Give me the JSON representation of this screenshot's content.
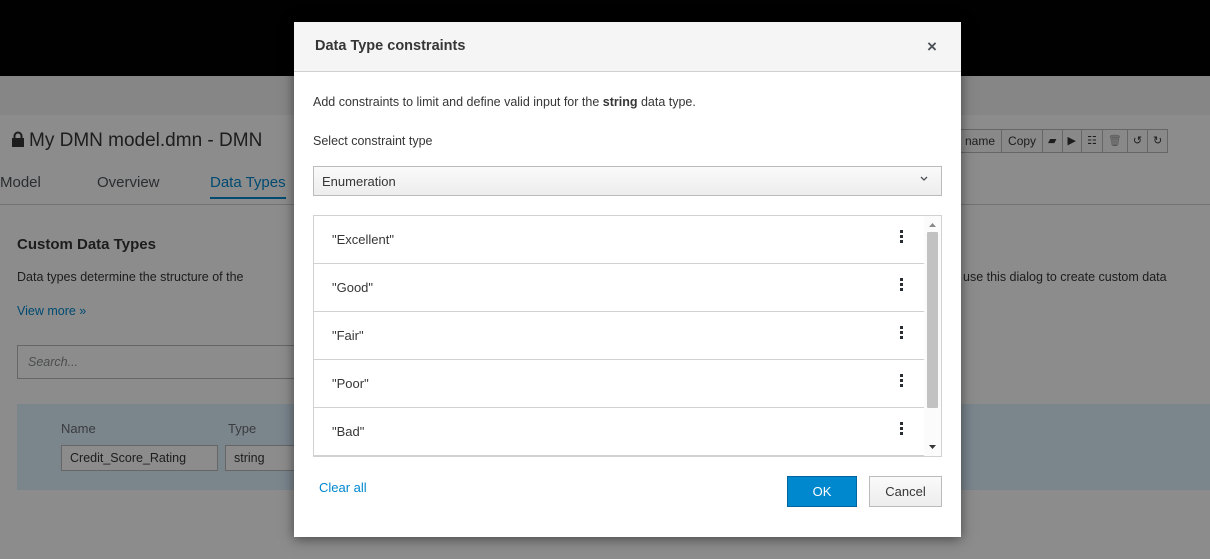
{
  "app": {
    "title": "My DMN model.dmn - DMN",
    "toolbar": [
      "name",
      "Copy"
    ],
    "tabs": [
      {
        "label": "Model",
        "active": false
      },
      {
        "label": "Overview",
        "active": false
      },
      {
        "label": "Data Types",
        "active": true
      }
    ],
    "heading": "Custom Data Types",
    "description_left": "Data types determine the structure of the",
    "description_right": "use this dialog to create custom data",
    "view_more": "View more »",
    "search_placeholder": "Search...",
    "table": {
      "name_header": "Name",
      "type_header": "Type",
      "name_value": "Credit_Score_Rating",
      "type_value": "string"
    }
  },
  "modal": {
    "title": "Data Type constraints",
    "close_label": "×",
    "description_prefix": "Add constraints to limit and define valid input for the ",
    "description_type": "string",
    "description_suffix": " data type.",
    "select_label": "Select constraint type",
    "select_value": "Enumeration",
    "enum_values": [
      "\"Excellent\"",
      "\"Good\"",
      "\"Fair\"",
      "\"Poor\"",
      "\"Bad\""
    ],
    "clear_all": "Clear all",
    "ok_label": "OK",
    "cancel_label": "Cancel"
  },
  "colors": {
    "accent": "#0088ce",
    "header_bg": "#030303",
    "row_highlight": "#def3ff"
  }
}
